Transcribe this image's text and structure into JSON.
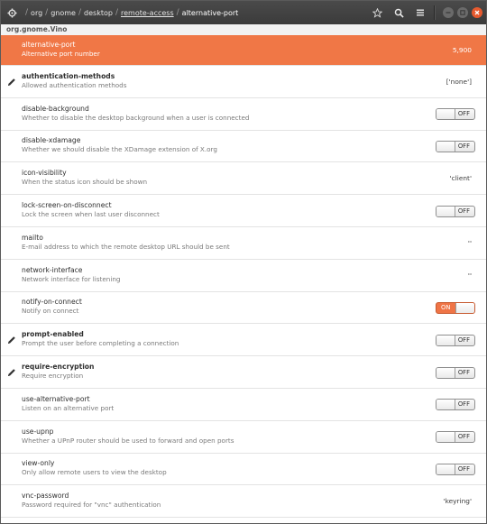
{
  "header": {
    "path": [
      {
        "label": "org",
        "key": "org"
      },
      {
        "label": "gnome",
        "key": "gnome"
      },
      {
        "label": "desktop",
        "key": "desktop"
      },
      {
        "label": "remote-access",
        "key": "remote-access"
      },
      {
        "label": "alternative-port",
        "key": "alternative-port"
      }
    ],
    "separator": "/",
    "icons": [
      "gear-icon",
      "star-icon",
      "search-icon",
      "menu-icon"
    ],
    "accent": "#e75a2f"
  },
  "schema": "org.gnome.Vino",
  "rows": [
    {
      "name": "alternative-port",
      "desc": "Alternative port number",
      "value": "5,900",
      "type": "value",
      "selected": true
    },
    {
      "name": "authentication-methods",
      "desc": "Allowed authentication methods",
      "value": "['none']",
      "type": "value",
      "modified": true
    },
    {
      "name": "disable-background",
      "desc": "Whether to disable the desktop background when a user is connected",
      "value": "OFF",
      "type": "toggle"
    },
    {
      "name": "disable-xdamage",
      "desc": "Whether we should disable the XDamage extension of X.org",
      "value": "OFF",
      "type": "toggle"
    },
    {
      "name": "icon-visibility",
      "desc": "When the status icon should be shown",
      "value": "'client'",
      "type": "value"
    },
    {
      "name": "lock-screen-on-disconnect",
      "desc": "Lock the screen when last user disconnect",
      "value": "OFF",
      "type": "toggle"
    },
    {
      "name": "mailto",
      "desc": "E-mail address to which the remote desktop URL should be sent",
      "value": "''",
      "type": "value"
    },
    {
      "name": "network-interface",
      "desc": "Network interface for listening",
      "value": "''",
      "type": "value"
    },
    {
      "name": "notify-on-connect",
      "desc": "Notify on connect",
      "value": "ON",
      "type": "toggle"
    },
    {
      "name": "prompt-enabled",
      "desc": "Prompt the user before completing a connection",
      "value": "OFF",
      "type": "toggle",
      "modified": true
    },
    {
      "name": "require-encryption",
      "desc": "Require encryption",
      "value": "OFF",
      "type": "toggle",
      "modified": true
    },
    {
      "name": "use-alternative-port",
      "desc": "Listen on an alternative port",
      "value": "OFF",
      "type": "toggle"
    },
    {
      "name": "use-upnp",
      "desc": "Whether a UPnP router should be used to forward and open ports",
      "value": "OFF",
      "type": "toggle"
    },
    {
      "name": "view-only",
      "desc": "Only allow remote users to view the desktop",
      "value": "OFF",
      "type": "toggle"
    },
    {
      "name": "vnc-password",
      "desc": "Password required for \"vnc\" authentication",
      "value": "'keyring'",
      "type": "value"
    }
  ]
}
